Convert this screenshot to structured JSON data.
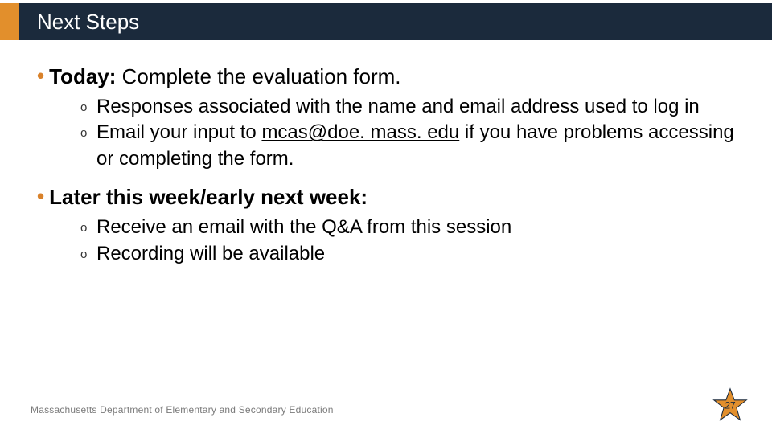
{
  "title": "Next Steps",
  "bullets": [
    {
      "lead": "Today:",
      "rest": " Complete the evaluation form.",
      "subs": [
        {
          "text": "Responses associated with the name and email address used to log in"
        },
        {
          "pre": "Email your input to ",
          "link": "mcas@doe. mass. edu",
          "post": " if you have problems accessing or completing the form."
        }
      ]
    },
    {
      "lead": "Later this week/early next week:",
      "rest": "",
      "subs": [
        {
          "text": "Receive an email with the Q&A from this session"
        },
        {
          "text": "Recording will be available"
        }
      ]
    }
  ],
  "footer": "Massachusetts Department of Elementary and Secondary Education",
  "page_number": "27",
  "colors": {
    "accent": "#e28f2c",
    "bar": "#1b2a3c",
    "bullet": "#d9822b",
    "star_fill": "#e28f2c",
    "star_stroke": "#1b2a3c"
  }
}
